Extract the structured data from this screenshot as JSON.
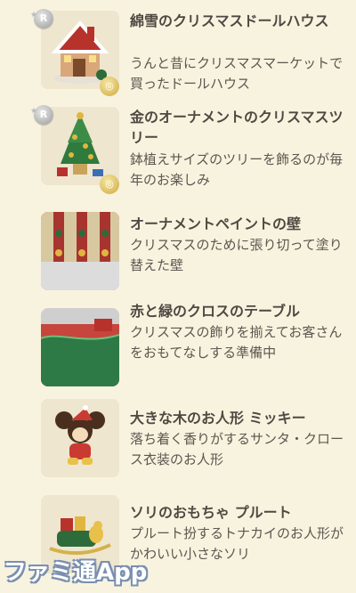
{
  "items": [
    {
      "title": "綿雪のクリスマスドールハウス",
      "description": "うんと昔にクリスマスマーケットで買ったドールハウス",
      "rank_badge": "R",
      "icon": "dollhouse-icon",
      "has_coin": true
    },
    {
      "title": "金のオーナメントのクリスマスツリー",
      "description": "鉢植えサイズのツリーを飾るのが毎年のお楽しみ",
      "rank_badge": "R",
      "icon": "christmas-tree-icon",
      "has_coin": true
    },
    {
      "title": "オーナメントペイントの壁",
      "description": "クリスマスのために張り切って塗り替えた壁",
      "icon": "wallpaper-icon"
    },
    {
      "title": "赤と緑のクロスのテーブル",
      "description": "クリスマスの飾りを揃えてお客さんをおもてなしする準備中",
      "icon": "table-icon"
    },
    {
      "title": "大きな木のお人形 ミッキー",
      "description": "落ち着く香りがするサンタ・クロース衣装のお人形",
      "icon": "mickey-doll-icon"
    },
    {
      "title": "ソリのおもちゃ プルート",
      "description": "プルート扮するトナカイのお人形がかわいい小さなソリ",
      "icon": "pluto-sleigh-icon"
    }
  ],
  "watermark": "ファミ通App",
  "colors": {
    "background": "#f8f3df",
    "text": "#4e4942"
  }
}
